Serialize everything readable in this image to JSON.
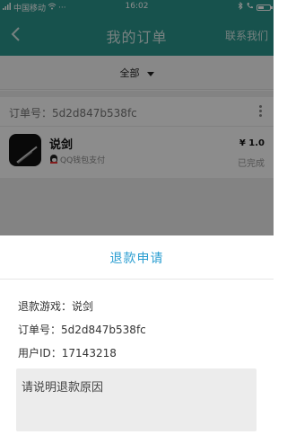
{
  "status_bar": {
    "carrier": "中国移动",
    "dots": "···",
    "time": "16:02",
    "icons": [
      "signal-icon",
      "wifi-icon",
      "bluetooth-icon",
      "battery-icon"
    ]
  },
  "navbar": {
    "back_icon": "chevron-left-icon",
    "title": "我的订单",
    "contact": "联系我们"
  },
  "filter": {
    "selected": "全部"
  },
  "order": {
    "order_no_label": "订单号：",
    "order_no": "5d2d847b538fc",
    "game_name": "说剑",
    "payment_method": "QQ钱包支付",
    "price": "¥ 1.0",
    "status": "已完成"
  },
  "refund_sheet": {
    "title": "退款申请",
    "game_label": "退款游戏：",
    "game_value": "说剑",
    "order_label": "订单号：",
    "order_value": "5d2d847b538fc",
    "user_label": "用户ID：",
    "user_value": "17143218",
    "reason_placeholder": "请说明退款原因"
  },
  "colors": {
    "primary": "#2a958c",
    "accent_title": "#2b9ed1"
  }
}
